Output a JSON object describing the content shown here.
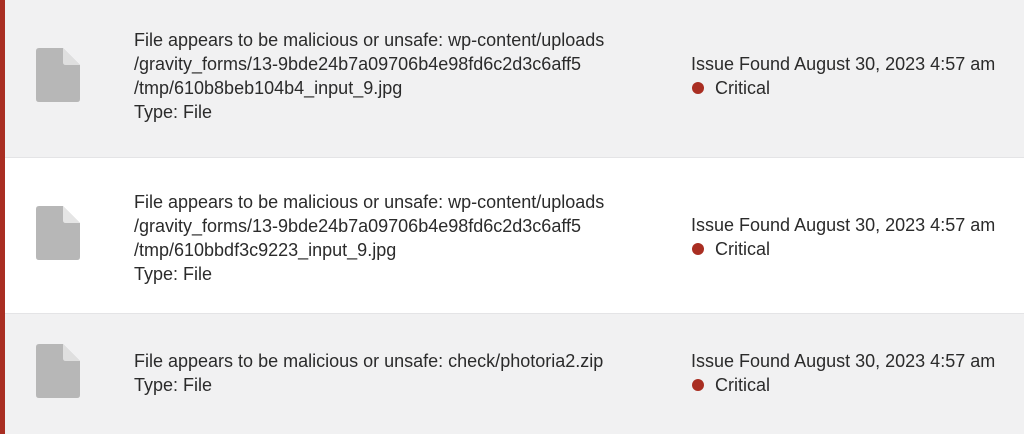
{
  "theme": {
    "accent_color": "#a92e22",
    "severity_critical_color": "#a92e22",
    "icon_color": "#b7b7b7"
  },
  "issues": [
    {
      "icon": "file-icon",
      "lines": [
        "File appears to be malicious or unsafe: wp-content/uploads",
        "/gravity_forms/13-9bde24b7a09706b4e98fd6c2d3c6aff5",
        "/tmp/610b8beb104b4_input_9.jpg"
      ],
      "type_label": "Type: File",
      "found": "Issue Found August 30, 2023 4:57 am",
      "severity": "Critical"
    },
    {
      "icon": "file-icon",
      "lines": [
        "File appears to be malicious or unsafe: wp-content/uploads",
        "/gravity_forms/13-9bde24b7a09706b4e98fd6c2d3c6aff5",
        "/tmp/610bbdf3c9223_input_9.jpg"
      ],
      "type_label": "Type: File",
      "found": "Issue Found August 30, 2023 4:57 am",
      "severity": "Critical"
    },
    {
      "icon": "file-icon",
      "lines": [
        "File appears to be malicious or unsafe: check/photoria2.zip"
      ],
      "type_label": "Type: File",
      "found": "Issue Found August 30, 2023 4:57 am",
      "severity": "Critical"
    }
  ]
}
